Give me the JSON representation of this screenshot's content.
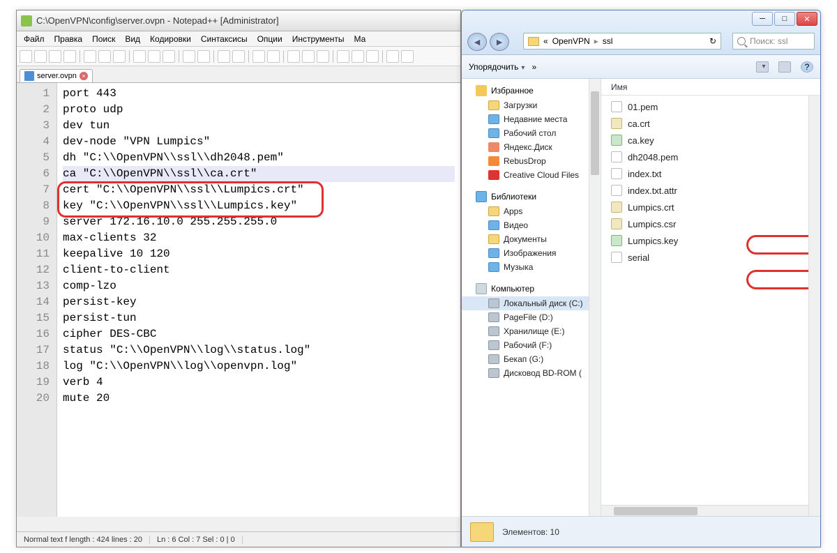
{
  "npp": {
    "title": "C:\\OpenVPN\\config\\server.ovpn - Notepad++ [Administrator]",
    "menu": [
      "Файл",
      "Правка",
      "Поиск",
      "Вид",
      "Кодировки",
      "Синтаксисы",
      "Опции",
      "Инструменты",
      "Ма"
    ],
    "tab": {
      "name": "server.ovpn"
    },
    "lines": [
      "port 443",
      "proto udp",
      "dev tun",
      "dev-node \"VPN Lumpics\"",
      "dh \"C:\\\\OpenVPN\\\\ssl\\\\dh2048.pem\"",
      "ca \"C:\\\\OpenVPN\\\\ssl\\\\ca.crt\"",
      "cert \"C:\\\\OpenVPN\\\\ssl\\\\Lumpics.crt\"",
      "key \"C:\\\\OpenVPN\\\\ssl\\\\Lumpics.key\"",
      "server 172.16.10.0 255.255.255.0",
      "max-clients 32",
      "keepalive 10 120",
      "client-to-client",
      "comp-lzo",
      "persist-key",
      "persist-tun",
      "cipher DES-CBC",
      "status \"C:\\\\OpenVPN\\\\log\\\\status.log\"",
      "log \"C:\\\\OpenVPN\\\\log\\\\openvpn.log\"",
      "verb 4",
      "mute 20"
    ],
    "status": {
      "left": "Normal text f  length : 424    lines : 20",
      "mid": "Ln : 6    Col : 7    Sel : 0 | 0"
    }
  },
  "explorer": {
    "win": {
      "min": "─",
      "max": "□",
      "close": "✕"
    },
    "breadcrumb": {
      "l1": "«",
      "l2": "OpenVPN",
      "l3": "ssl",
      "sep": "▸"
    },
    "refresh": "↻",
    "search_placeholder": "Поиск: ssl",
    "toolbar": {
      "org": "Упорядочить",
      "more": "»"
    },
    "tree": {
      "fav": "Избранное",
      "fav_items": [
        "Загрузки",
        "Недавние места",
        "Рабочий стол",
        "Яндекс.Диск",
        "RebusDrop",
        "Creative Cloud Files"
      ],
      "lib": "Библиотеки",
      "lib_items": [
        "Apps",
        "Видео",
        "Документы",
        "Изображения",
        "Музыка"
      ],
      "comp": "Компьютер",
      "comp_items": [
        "Локальный диск (C:)",
        "PageFile (D:)",
        "Хранилище (E:)",
        "Рабочий (F:)",
        "Бекап (G:)",
        "Дисковод BD-ROM ("
      ]
    },
    "col_name": "Имя",
    "files": [
      "01.pem",
      "ca.crt",
      "ca.key",
      "dh2048.pem",
      "index.txt",
      "index.txt.attr",
      "Lumpics.crt",
      "Lumpics.csr",
      "Lumpics.key",
      "serial"
    ],
    "status": "Элементов: 10"
  }
}
